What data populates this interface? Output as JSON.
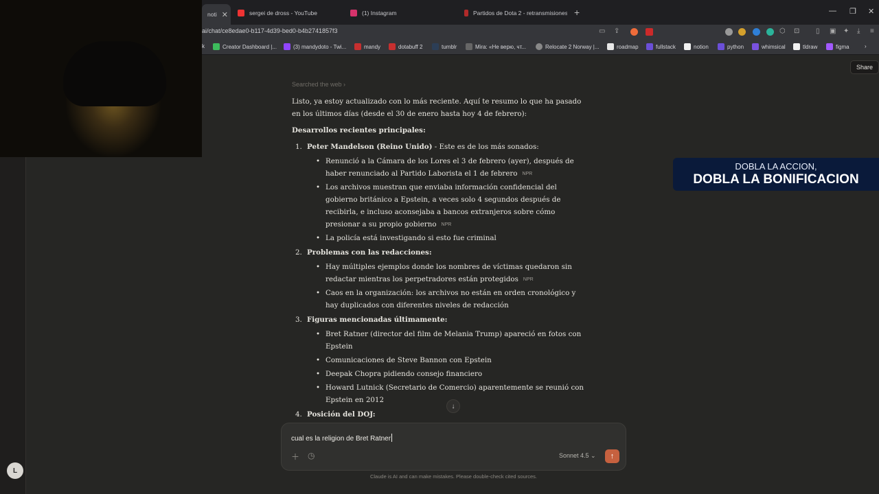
{
  "browser": {
    "tabs": [
      {
        "label": "noti",
        "active": true
      },
      {
        "label": "sergei de dross - YouTube"
      },
      {
        "label": "(1) Instagram"
      },
      {
        "label": "Partidos de Dota 2 - retransmisiones"
      }
    ],
    "url": "ai/chat/ce8edae0-b117-4d39-bed0-b4b2741857f3",
    "bookmarks": [
      "k",
      "Creator Dashboard |...",
      "(3) mandydoto - Twi...",
      "mandy",
      "dotabuff 2",
      "tumblr",
      "Mira: «Не верю, чт...",
      "Relocate 2 Norway |...",
      "roadmap",
      "fullstack",
      "notion",
      "python",
      "whimsical",
      "tldraw",
      "figma"
    ]
  },
  "header": {
    "share_label": "Share"
  },
  "sidebar": {
    "avatar_initial": "L"
  },
  "chat": {
    "searched_label": "Searched the web ›",
    "intro": "Listo, ya estoy actualizado con lo más reciente. Aquí te resumo lo que ha pasado en los últimos días (desde el 30 de enero hasta hoy 4 de febrero):",
    "heading": "Desarrollos recientes principales:",
    "sections": [
      {
        "num": "1.",
        "title": "Peter Mandelson (Reino Unido)",
        "title_suffix": " - Este es de los más sonados:",
        "bullets": [
          {
            "text": "Renunció a la Cámara de los Lores el 3 de febrero (ayer), después de haber renunciado al Partido Laborista el 1 de febrero",
            "cite": "NPR"
          },
          {
            "text": "Los archivos muestran que enviaba información confidencial del gobierno británico a Epstein, a veces solo 4 segundos después de recibirla, e incluso aconsejaba a bancos extranjeros sobre cómo presionar a su propio gobierno",
            "cite": "NPR"
          },
          {
            "text": "La policía está investigando si esto fue criminal",
            "cite": ""
          }
        ]
      },
      {
        "num": "2.",
        "title": "Problemas con las redacciones:",
        "title_suffix": "",
        "bullets": [
          {
            "text": "Hay múltiples ejemplos donde los nombres de víctimas quedaron sin redactar mientras los perpetradores están protegidos",
            "cite": "NPR"
          },
          {
            "text": "Caos en la organización: los archivos no están en orden cronológico y hay duplicados con diferentes niveles de redacción",
            "cite": ""
          }
        ]
      },
      {
        "num": "3.",
        "title": "Figuras mencionadas últimamente:",
        "title_suffix": "",
        "bullets": [
          {
            "text": "Bret Ratner (director del film de Melania Trump) apareció en fotos con Epstein",
            "cite": ""
          },
          {
            "text": "Comunicaciones de Steve Bannon con Epstein",
            "cite": ""
          },
          {
            "text": "Deepak Chopra pidiendo consejo financiero",
            "cite": ""
          },
          {
            "text": "Howard Lutnick (Secretario de Comercio) aparentemente se reunió con Epstein en 2012",
            "cite": ""
          }
        ]
      },
      {
        "num": "4.",
        "title": "Posición del DOJ:",
        "title_suffix": "",
        "bullets": []
      }
    ]
  },
  "composer": {
    "input_value": "cual es la religion de Bret Ratner",
    "model": "Sonnet 4.5 ⌄",
    "disclaimer": "Claude is AI and can make mistakes. Please double-check cited sources."
  },
  "overlay": {
    "promo_line1": "DOBLA LA ACCION,",
    "promo_line2": "DOBLA LA BONIFICACION"
  },
  "colors": {
    "background": "#262624",
    "send_accent": "#c6613f",
    "promo_bg": "#0a1a3a"
  }
}
